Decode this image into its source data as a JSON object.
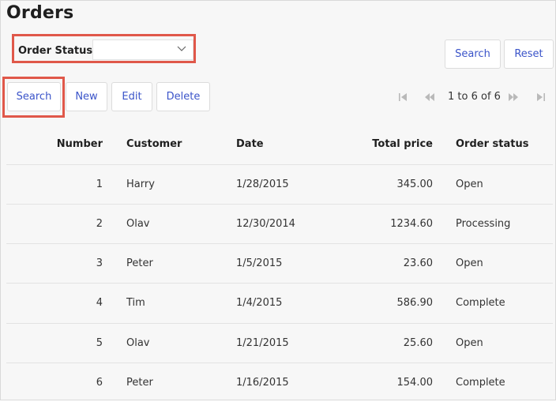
{
  "page": {
    "title": "Orders"
  },
  "filter": {
    "label": "Order Status",
    "value": ""
  },
  "filter_actions": {
    "search_label": "Search",
    "reset_label": "Reset"
  },
  "toolbar": {
    "search_label": "Search",
    "new_label": "New",
    "edit_label": "Edit",
    "delete_label": "Delete"
  },
  "pager": {
    "text": "1 to 6 of 6"
  },
  "icons": {
    "dropdown": "chevron-down-icon",
    "first": "first-page-icon",
    "prev": "previous-page-icon",
    "next": "next-page-icon",
    "last": "last-page-icon"
  },
  "colors": {
    "highlight": "#e0584a",
    "link": "#3b54c9"
  },
  "table": {
    "columns": [
      "Number",
      "Customer",
      "Date",
      "Total price",
      "Order status"
    ],
    "rows": [
      {
        "number": "1",
        "customer": "Harry",
        "date": "1/28/2015",
        "total": "345.00",
        "status": "Open"
      },
      {
        "number": "2",
        "customer": "Olav",
        "date": "12/30/2014",
        "total": "1234.60",
        "status": "Processing"
      },
      {
        "number": "3",
        "customer": "Peter",
        "date": "1/5/2015",
        "total": "23.60",
        "status": "Open"
      },
      {
        "number": "4",
        "customer": "Tim",
        "date": "1/4/2015",
        "total": "586.90",
        "status": "Complete"
      },
      {
        "number": "5",
        "customer": "Olav",
        "date": "1/21/2015",
        "total": "25.60",
        "status": "Open"
      },
      {
        "number": "6",
        "customer": "Peter",
        "date": "1/16/2015",
        "total": "154.00",
        "status": "Complete"
      }
    ]
  }
}
